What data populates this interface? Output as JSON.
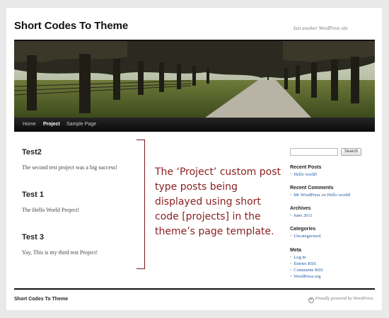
{
  "header": {
    "site_title": "Short Codes To Theme",
    "tagline": "Just another WordPress site"
  },
  "nav": {
    "items": [
      {
        "label": "Home",
        "active": false
      },
      {
        "label": "Project",
        "active": true
      },
      {
        "label": "Sample Page",
        "active": false
      }
    ]
  },
  "posts": [
    {
      "title": "Test2",
      "body": "The second test project was a big success!"
    },
    {
      "title": "Test 1",
      "body": "The Hello World Project!"
    },
    {
      "title": "Test 3",
      "body": "Yay, This is my third test Project!"
    }
  ],
  "callout": {
    "text": "The ‘Project’ custom post type posts being displayed using short code [projects] in the theme’s page template."
  },
  "sidebar": {
    "search_button": "Search",
    "recent_posts": {
      "title": "Recent Posts",
      "items": [
        "Hello world!"
      ]
    },
    "recent_comments": {
      "title": "Recent Comments",
      "author": "Mr WordPress",
      "on": "on",
      "post": "Hello world!"
    },
    "archives": {
      "title": "Archives",
      "items": [
        "June 2011"
      ]
    },
    "categories": {
      "title": "Categories",
      "items": [
        "Uncategorized"
      ]
    },
    "meta": {
      "title": "Meta",
      "items": [
        "Log in",
        "Entries RSS",
        "Comments RSS",
        "WordPress.org"
      ]
    }
  },
  "footer": {
    "site_title": "Short Codes To Theme",
    "credit": "Proudly powered by WordPress."
  },
  "colors": {
    "callout": "#8b1e1e",
    "link": "#1b58a6",
    "nav_bg": "#111111"
  }
}
